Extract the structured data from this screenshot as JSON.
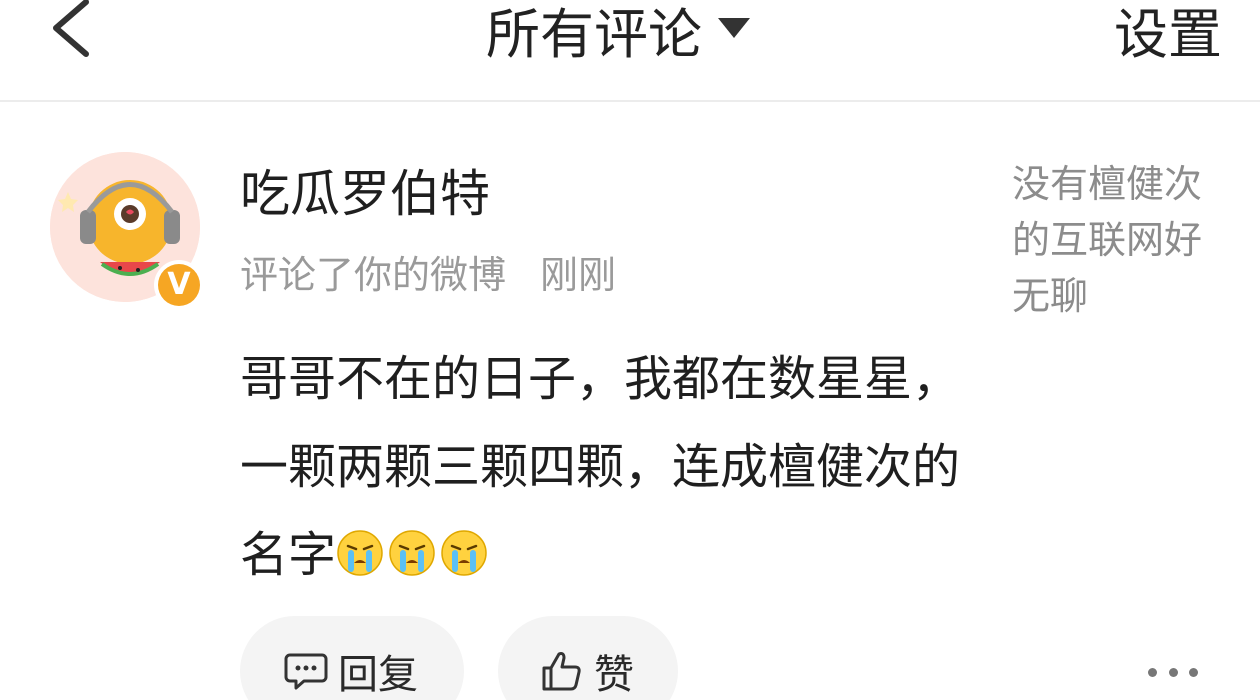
{
  "header": {
    "title": "所有评论",
    "settings_label": "设置"
  },
  "comment": {
    "username": "吃瓜罗伯特",
    "action_text": "评论了你的微博",
    "time": "刚刚",
    "body_text": "哥哥不在的日子，我都在数星星，一颗两颗三颗四颗，连成檀健次的名字",
    "emoji_count": 3,
    "badge_letter": "V",
    "preview_text": "没有檀健次的互联网好无聊",
    "reply_label": "回复",
    "like_label": "赞"
  },
  "icons": {
    "back": "back-arrow-icon",
    "dropdown": "triangle-down-icon",
    "emoji": "crying-face-icon",
    "reply": "comment-bubble-icon",
    "like": "thumbs-up-icon",
    "more": "more-dots-icon"
  },
  "colors": {
    "badge": "#f6a623",
    "meta_text": "#9a9a9a",
    "button_bg": "#f4f4f4"
  }
}
